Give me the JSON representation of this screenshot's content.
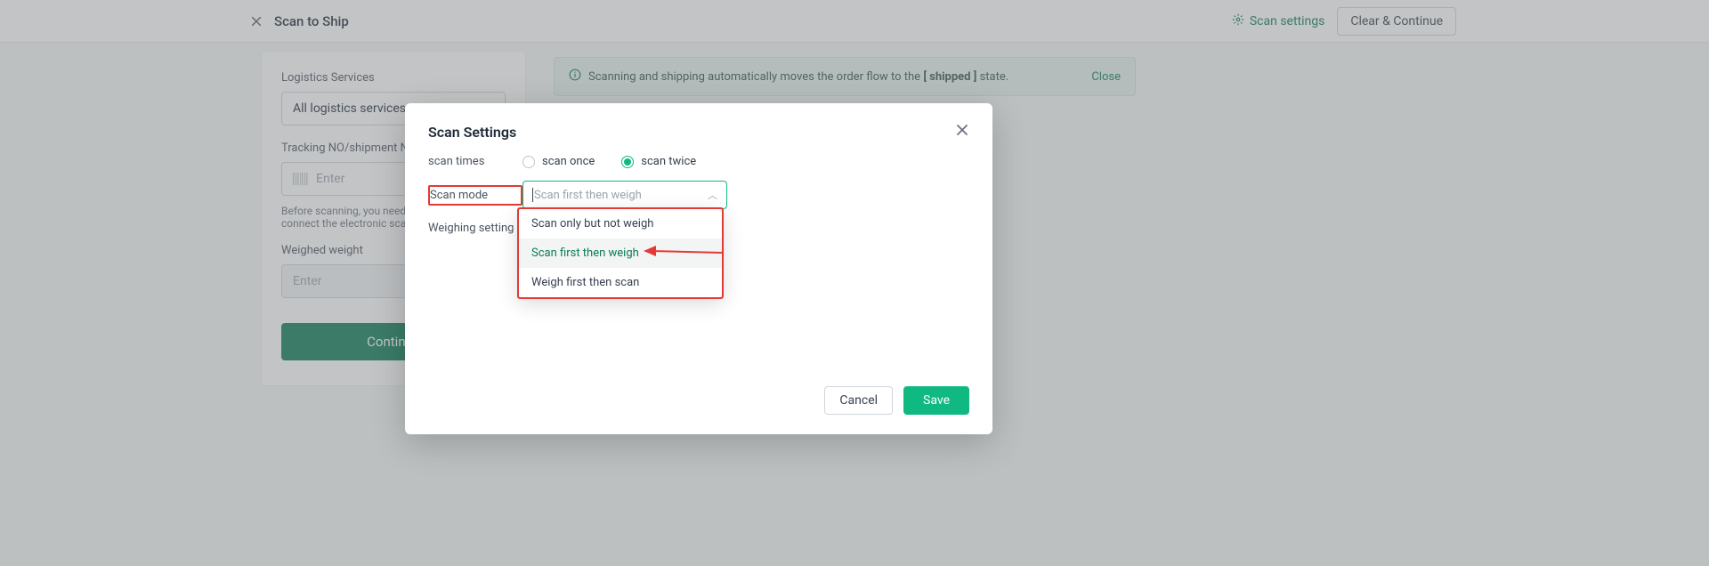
{
  "topbar": {
    "title": "Scan to Ship",
    "scan_settings_label": "Scan settings",
    "clear_continue_label": "Clear & Continue"
  },
  "left_panel": {
    "logistics_label": "Logistics Services",
    "logistics_value": "All logistics services",
    "tracking_label": "Tracking NO/shipment NO/order NO",
    "tracking_placeholder": "Enter",
    "hint": "Before scanning, you need to set up and connect the electronic scale",
    "weighed_label": "Weighed weight",
    "weighed_placeholder": "Enter",
    "continue_label": "Continue"
  },
  "alert": {
    "text_prefix": "Scanning and shipping automatically moves the order flow to the",
    "status_token": "[ shipped ]",
    "text_suffix": "state.",
    "close_label": "Close"
  },
  "modal": {
    "title": "Scan Settings",
    "rows": {
      "scan_times_label": "scan times",
      "scan_once_label": "scan once",
      "scan_twice_label": "scan twice",
      "scan_mode_label": "Scan mode",
      "weighing_setting_label": "Weighing setting"
    },
    "scan_mode_select": {
      "placeholder": "Scan first then weigh",
      "options": [
        "Scan only but not weigh",
        "Scan first then weigh",
        "Weigh first then scan"
      ],
      "selected_index": 1
    },
    "cancel_label": "Cancel",
    "save_label": "Save"
  }
}
